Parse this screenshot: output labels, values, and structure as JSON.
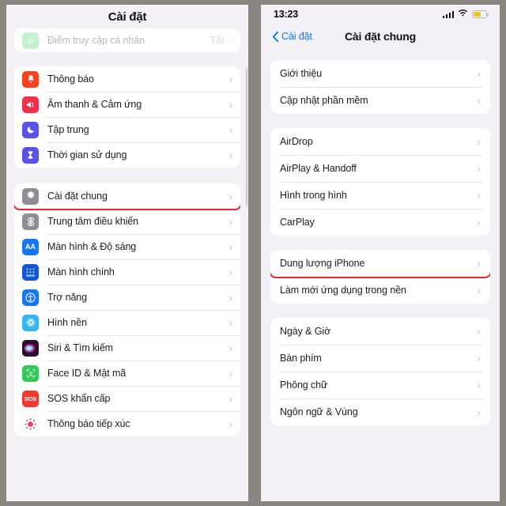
{
  "colors": {
    "highlight": "#e8262b",
    "accent_blue": "#0a7bf0",
    "page_bg": "#f1f1f6",
    "card_bg": "#ffffff",
    "chevron": "#c4c4c8",
    "battery_fill": "#f5c518"
  },
  "left_screen": {
    "title": "Cài đặt",
    "groups": [
      {
        "name": "hotspot-group",
        "rows": [
          {
            "label": "Điểm truy cập cá nhân",
            "value": "Tắt",
            "icon": "personal-hotspot-icon",
            "icon_color": "#4cd471",
            "faded": true
          }
        ]
      },
      {
        "name": "notifications-group",
        "rows": [
          {
            "label": "Thông báo",
            "icon": "bell-icon",
            "icon_color": "#f6411f"
          },
          {
            "label": "Âm thanh & Cảm ứng",
            "icon": "speaker-icon",
            "icon_color": "#f12f4b"
          },
          {
            "label": "Tập trung",
            "icon": "moon-icon",
            "icon_color": "#5a53e8"
          },
          {
            "label": "Thời gian sử dụng",
            "icon": "hourglass-icon",
            "icon_color": "#5a53e8"
          }
        ]
      },
      {
        "name": "general-group",
        "rows": [
          {
            "label": "Cài đặt chung",
            "icon": "gear-icon",
            "icon_color": "#8e8e93",
            "highlighted": true
          },
          {
            "label": "Trung tâm điều khiển",
            "icon": "control-center-icon",
            "icon_color": "#8e8e93"
          },
          {
            "label": "Màn hình & Độ sáng",
            "icon": "display-brightness-icon",
            "icon_color": "#1677f2"
          },
          {
            "label": "Màn hình chính",
            "icon": "home-screen-icon",
            "icon_color": "#1852d6"
          },
          {
            "label": "Trợ năng",
            "icon": "accessibility-icon",
            "icon_color": "#1677f2"
          },
          {
            "label": "Hình nền",
            "icon": "wallpaper-icon",
            "icon_color": "#36b6ef"
          },
          {
            "label": "Siri & Tìm kiếm",
            "icon": "siri-icon",
            "icon_color": "#2b1030"
          },
          {
            "label": "Face ID & Mật mã",
            "icon": "face-id-icon",
            "icon_color": "#34c759"
          },
          {
            "label": "SOS khẩn cấp",
            "icon": "sos-icon",
            "icon_color": "#f03a2e",
            "icon_text": "SOS"
          },
          {
            "label": "Thông báo tiếp xúc",
            "icon": "exposure-notification-icon",
            "icon_color": "#ffffff"
          }
        ]
      }
    ]
  },
  "right_screen": {
    "status_bar": {
      "time": "13:23",
      "cellular_icon": "cellular-bars-icon",
      "wifi_icon": "wifi-icon",
      "battery_icon": "battery-icon"
    },
    "nav": {
      "back_label": "Cài đặt",
      "back_icon": "chevron-left-icon",
      "title": "Cài đặt chung"
    },
    "groups": [
      {
        "name": "about-group",
        "rows": [
          {
            "label": "Giới thiệu"
          },
          {
            "label": "Cập nhật phần mềm"
          }
        ]
      },
      {
        "name": "sharing-group",
        "rows": [
          {
            "label": "AirDrop"
          },
          {
            "label": "AirPlay & Handoff"
          },
          {
            "label": "Hình trong hình"
          },
          {
            "label": "CarPlay"
          }
        ]
      },
      {
        "name": "storage-group",
        "rows": [
          {
            "label": "Dung lượng iPhone",
            "highlighted": true
          },
          {
            "label": "Làm mới ứng dụng trong nền"
          }
        ]
      },
      {
        "name": "locale-group",
        "rows": [
          {
            "label": "Ngày & Giờ"
          },
          {
            "label": "Bàn phím"
          },
          {
            "label": "Phông chữ"
          },
          {
            "label": "Ngôn ngữ & Vùng"
          }
        ]
      }
    ]
  }
}
